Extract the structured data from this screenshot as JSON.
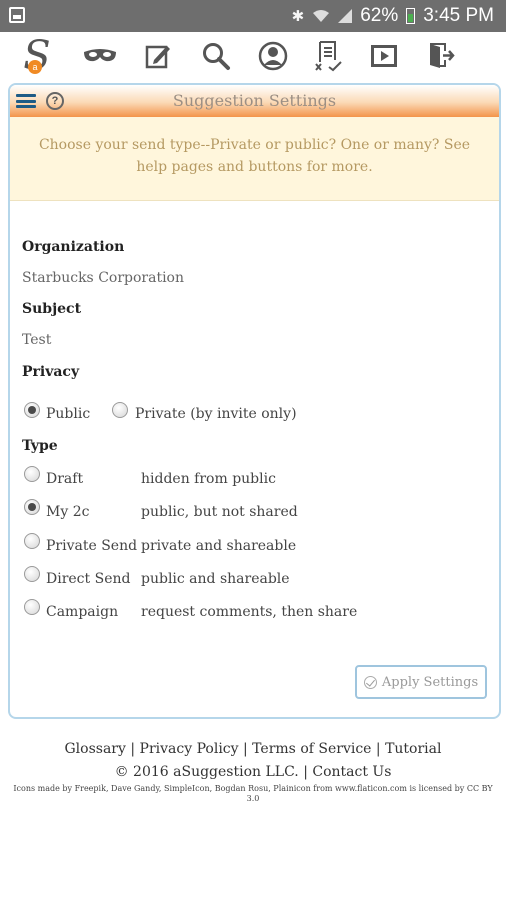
{
  "status_bar": {
    "battery": "62%",
    "time": "3:45 PM"
  },
  "nav": {
    "logo_letter": "S",
    "logo_badge": "a",
    "icons": [
      "mask-icon",
      "edit-icon",
      "search-icon",
      "profile-icon",
      "document-check-icon",
      "video-icon",
      "exit-icon"
    ]
  },
  "panel": {
    "title": "Suggestion Settings",
    "help_glyph": "?",
    "banner": "Choose your send type--Private or public? One or many? See help pages and buttons for more.",
    "organization_label": "Organization",
    "organization_value": "Starbucks Corporation",
    "subject_label": "Subject",
    "subject_value": "Test",
    "privacy_label": "Privacy",
    "privacy_options": [
      {
        "label": "Public",
        "checked": true
      },
      {
        "label": "Private (by invite only)",
        "checked": false
      }
    ],
    "type_label": "Type",
    "type_options": [
      {
        "label": "Draft",
        "desc": "hidden from public",
        "checked": false
      },
      {
        "label": "My 2c",
        "desc": "public, but not shared",
        "checked": true
      },
      {
        "label": "Private Send",
        "desc": "private and shareable",
        "checked": false
      },
      {
        "label": "Direct Send",
        "desc": "public and shareable",
        "checked": false
      },
      {
        "label": "Campaign",
        "desc": "request comments, then share",
        "checked": false
      }
    ],
    "apply_label": "Apply Settings"
  },
  "footer": {
    "links": "Glossary | Privacy Policy | Terms of Service | Tutorial",
    "copyright": "© 2016 aSuggestion LLC. | Contact Us",
    "credits": "Icons made by Freepik, Dave Gandy, SimpleIcon, Bogdan Rosu, Plainicon from www.flaticon.com is licensed by CC BY 3.0"
  },
  "colors": {
    "accent": "#3b8ec4",
    "header_orange": "#f3944a",
    "banner_bg": "#fff6dc",
    "banner_text": "#b59962"
  }
}
